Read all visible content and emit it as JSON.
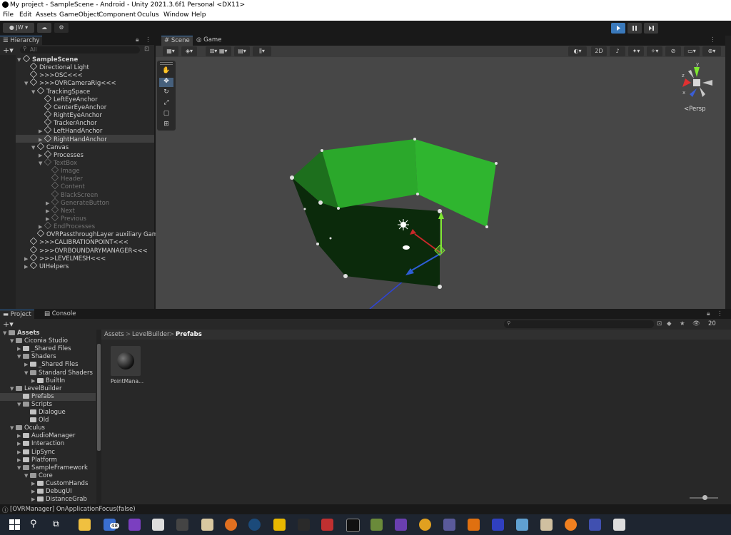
{
  "window": {
    "title": "My project - SampleScene - Android - Unity 2021.3.6f1 Personal <DX11>"
  },
  "menu": [
    "File",
    "Edit",
    "Assets",
    "GameObject",
    "Component",
    "Oculus",
    "Window",
    "Help"
  ],
  "toolbar": {
    "account": "JW"
  },
  "hierarchy": {
    "tab": "Hierarchy",
    "search_placeholder": "All",
    "items": [
      {
        "label": "SampleScene",
        "indent": 0,
        "arrow": "▼",
        "icon": "unity-scene-icon",
        "dim": false,
        "bold": true
      },
      {
        "label": "Directional Light",
        "indent": 1,
        "arrow": "",
        "icon": "cube-icon",
        "dim": false
      },
      {
        "label": ">>>OSC<<<",
        "indent": 1,
        "arrow": "",
        "icon": "cube-icon",
        "dim": false
      },
      {
        "label": ">>>OVRCameraRig<<<",
        "indent": 1,
        "arrow": "▼",
        "icon": "cube-icon",
        "dim": false
      },
      {
        "label": "TrackingSpace",
        "indent": 2,
        "arrow": "▼",
        "icon": "cube-icon",
        "dim": false
      },
      {
        "label": "LeftEyeAnchor",
        "indent": 3,
        "arrow": "",
        "icon": "cube-icon",
        "dim": false
      },
      {
        "label": "CenterEyeAnchor",
        "indent": 3,
        "arrow": "",
        "icon": "cube-icon",
        "dim": false
      },
      {
        "label": "RightEyeAnchor",
        "indent": 3,
        "arrow": "",
        "icon": "cube-icon",
        "dim": false
      },
      {
        "label": "TrackerAnchor",
        "indent": 3,
        "arrow": "",
        "icon": "cube-icon",
        "dim": false
      },
      {
        "label": "LeftHandAnchor",
        "indent": 3,
        "arrow": "▶",
        "icon": "cube-icon",
        "dim": false
      },
      {
        "label": "RightHandAnchor",
        "indent": 3,
        "arrow": "▶",
        "icon": "cube-icon",
        "dim": false,
        "selected": true
      },
      {
        "label": "Canvas",
        "indent": 2,
        "arrow": "▼",
        "icon": "cube-icon",
        "dim": false
      },
      {
        "label": "Processes",
        "indent": 3,
        "arrow": "▶",
        "icon": "cube-icon",
        "dim": false
      },
      {
        "label": "TextBox",
        "indent": 3,
        "arrow": "▼",
        "icon": "cube-icon",
        "dim": true
      },
      {
        "label": "Image",
        "indent": 4,
        "arrow": "",
        "icon": "cube-icon",
        "dim": true
      },
      {
        "label": "Header",
        "indent": 4,
        "arrow": "",
        "icon": "cube-icon",
        "dim": true
      },
      {
        "label": "Content",
        "indent": 4,
        "arrow": "",
        "icon": "cube-icon",
        "dim": true
      },
      {
        "label": "BlackScreen",
        "indent": 4,
        "arrow": "",
        "icon": "cube-icon",
        "dim": true
      },
      {
        "label": "GenerateButton",
        "indent": 4,
        "arrow": "▶",
        "icon": "cube-icon",
        "dim": true
      },
      {
        "label": "Next",
        "indent": 4,
        "arrow": "▶",
        "icon": "cube-icon",
        "dim": true
      },
      {
        "label": "Previous",
        "indent": 4,
        "arrow": "▶",
        "icon": "cube-icon",
        "dim": true
      },
      {
        "label": "EndProcesses",
        "indent": 3,
        "arrow": "▶",
        "icon": "cube-icon",
        "dim": true
      },
      {
        "label": "OVRPassthroughLayer auxiliary GameO",
        "indent": 2,
        "arrow": "",
        "icon": "cube-icon",
        "dim": false
      },
      {
        "label": ">>>CALIBRATIONPOINT<<<",
        "indent": 1,
        "arrow": "",
        "icon": "cube-icon",
        "dim": false
      },
      {
        "label": ">>>OVRBOUNDARYMANAGER<<<",
        "indent": 1,
        "arrow": "",
        "icon": "cube-icon",
        "dim": false
      },
      {
        "label": ">>>LEVELMESH<<<",
        "indent": 1,
        "arrow": "▶",
        "icon": "cube-icon",
        "dim": false
      },
      {
        "label": "UIHelpers",
        "indent": 1,
        "arrow": "▶",
        "icon": "cube-icon",
        "dim": false
      }
    ]
  },
  "scene_view": {
    "tabs": [
      "Scene",
      "Game"
    ],
    "toggle_2d": "2D",
    "projection": "<Persp",
    "gizmo_axes": {
      "y": "y",
      "x": "x",
      "z": "z"
    },
    "colors": {
      "panel_light": "#2db52d",
      "panel_mid": "#27a127",
      "panel_dark": "#1a6b1a",
      "floor": "#0b2a0b",
      "background": "#474747"
    }
  },
  "project": {
    "tabs": [
      "Project",
      "Console"
    ],
    "tree": [
      {
        "label": "Assets",
        "indent": 0,
        "arrow": "▼",
        "bold": true,
        "open": true
      },
      {
        "label": "Ciconia Studio",
        "indent": 1,
        "arrow": "▼",
        "open": true
      },
      {
        "label": "_Shared Files",
        "indent": 2,
        "arrow": "▶"
      },
      {
        "label": "Shaders",
        "indent": 2,
        "arrow": "▼",
        "open": true
      },
      {
        "label": "_Shared Files",
        "indent": 3,
        "arrow": "▶"
      },
      {
        "label": "Standard Shaders",
        "indent": 3,
        "arrow": "▼",
        "open": true
      },
      {
        "label": "BuiltIn",
        "indent": 4,
        "arrow": "▶"
      },
      {
        "label": "LevelBuilder",
        "indent": 1,
        "arrow": "▼",
        "open": true
      },
      {
        "label": "Prefabs",
        "indent": 2,
        "arrow": "",
        "selected": true
      },
      {
        "label": "Scripts",
        "indent": 2,
        "arrow": "▼",
        "open": true
      },
      {
        "label": "Dialogue",
        "indent": 3,
        "arrow": ""
      },
      {
        "label": "Old",
        "indent": 3,
        "arrow": ""
      },
      {
        "label": "Oculus",
        "indent": 1,
        "arrow": "▼",
        "open": true
      },
      {
        "label": "AudioManager",
        "indent": 2,
        "arrow": "▶"
      },
      {
        "label": "Interaction",
        "indent": 2,
        "arrow": "▶"
      },
      {
        "label": "LipSync",
        "indent": 2,
        "arrow": "▶"
      },
      {
        "label": "Platform",
        "indent": 2,
        "arrow": "▶"
      },
      {
        "label": "SampleFramework",
        "indent": 2,
        "arrow": "▼",
        "open": true
      },
      {
        "label": "Core",
        "indent": 3,
        "arrow": "▼",
        "open": true
      },
      {
        "label": "CustomHands",
        "indent": 4,
        "arrow": "▶"
      },
      {
        "label": "DebugUI",
        "indent": 4,
        "arrow": "▶"
      },
      {
        "label": "DistanceGrab",
        "indent": 4,
        "arrow": "▶"
      }
    ],
    "breadcrumb": [
      "Assets",
      "LevelBuilder",
      "Prefabs"
    ],
    "assets": [
      {
        "label": "PointMana..."
      }
    ],
    "hidden_count": "20"
  },
  "status": {
    "message": "[OVRManager] OnApplicationFocus(false)"
  },
  "taskbar": {
    "badge": "48"
  }
}
